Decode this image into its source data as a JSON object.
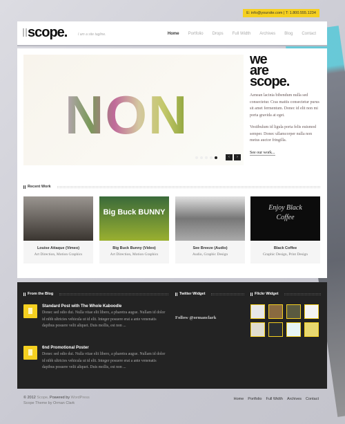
{
  "topbar": {
    "contact": "E: info@yoursite.com | T: 1.800.555.1234"
  },
  "header": {
    "logo": "scope.",
    "tagline": "I am a site tagline.",
    "nav": [
      "Home",
      "Portfolio",
      "Drops",
      "Full Width",
      "Archives",
      "Blog",
      "Contact"
    ],
    "active": "Home"
  },
  "slider": {
    "headline": "NON",
    "dots": 5,
    "active_dot": 5,
    "prev": "‹",
    "next": "›"
  },
  "intro": {
    "title_lines": [
      "we",
      "are",
      "scope."
    ],
    "para1": "Aenean lacinia bibendum nulla sed consectetur. Cras mattis consectetur purus sit amet fermentum. Donec id elit non mi porta gravida at eget.",
    "para2": "Vestibulum id ligula porta felis euismod semper. Donec ullamcorper nulla non metus auctor fringilla.",
    "link": "See our work..."
  },
  "recent_work": {
    "heading": "Recent Work",
    "items": [
      {
        "title": "Louise Attaque (Vimeo)",
        "tags": "Art Direction, Motion Graphics",
        "color": "#6a6560"
      },
      {
        "title": "Big Buck Bunny (Video)",
        "tags": "Art Direction, Motion Graphics",
        "color": "#6a8a30",
        "overlay": "Big Buck BUNNY"
      },
      {
        "title": "See Breeze (Audio)",
        "tags": "Audio, Graphic Design",
        "color": "#8a8a8a"
      },
      {
        "title": "Black Coffee",
        "tags": "Graphic Design, Print Design",
        "color": "#0c0c0c",
        "overlay": "Enjoy Black Coffee"
      }
    ]
  },
  "widgets": {
    "blog": {
      "heading": "From the Blog",
      "posts": [
        {
          "title": "Standard Post with The Whole Kaboodle",
          "excerpt": "Donec sed odio dui. Nulla vitae elit libero, a pharetra augue. Nullam id dolor id nibh ultricies vehicula ut id elit. Integer posuere erat a ante venenatis dapibus posuere velit aliquet. Duis mollis, est non ..."
        },
        {
          "title": "6nd Promotional Poster",
          "excerpt": "Donec sed odio dui. Nulla vitae elit libero, a pharetra augue. Nullam id dolor id nibh ultricies vehicula ut id elit. Integer posuere erat a ante venenatis dapibus posuere velit aliquet. Duis mollis, est non ..."
        }
      ]
    },
    "twitter": {
      "heading": "Twitter Widget",
      "follow": "Follow @ormanclark"
    },
    "flickr": {
      "heading": "Flickr Widget",
      "thumbs": [
        "#e8e8e8",
        "#8a6a40",
        "#5a5a40",
        "#f4f4f4",
        "#e0ddd0",
        "#2a2e30",
        "#e6f4f6",
        "#e8d870"
      ]
    }
  },
  "footer": {
    "copyright": "© 2012",
    "site": "Scope",
    "powered": ". Powered by",
    "wp": "WordPress",
    "credit": "Scope Theme by Orman Clark",
    "nav": [
      "Home",
      "Portfolio",
      "Full Width",
      "Archives",
      "Contact"
    ]
  }
}
